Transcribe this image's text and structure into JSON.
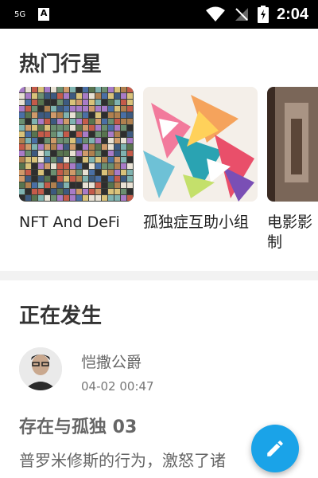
{
  "status_bar": {
    "network": "5G",
    "time": "2:04",
    "icons": [
      "notification-a-icon",
      "wifi-icon",
      "no-signal-icon",
      "battery-icon"
    ]
  },
  "hot_planets": {
    "title": "热门行星",
    "cards": [
      {
        "label": "NFT And DeFi",
        "image": "nft-collage-thumbnail"
      },
      {
        "label": "孤独症互助小组",
        "image": "colorful-abstract-thumbnail"
      },
      {
        "label": "电影影制",
        "image": "film-still-thumbnail"
      }
    ]
  },
  "happening": {
    "title": "正在发生",
    "post": {
      "author": "恺撒公爵",
      "time": "04-02 00:47",
      "title": "存在与孤独 03",
      "body": "普罗米修斯的行为，激怒了诸"
    }
  },
  "fab": {
    "icon": "pencil-edit-icon"
  },
  "colors": {
    "accent": "#1aa3e8",
    "status_bar": "#000000",
    "divider": "#f2f2f2"
  }
}
